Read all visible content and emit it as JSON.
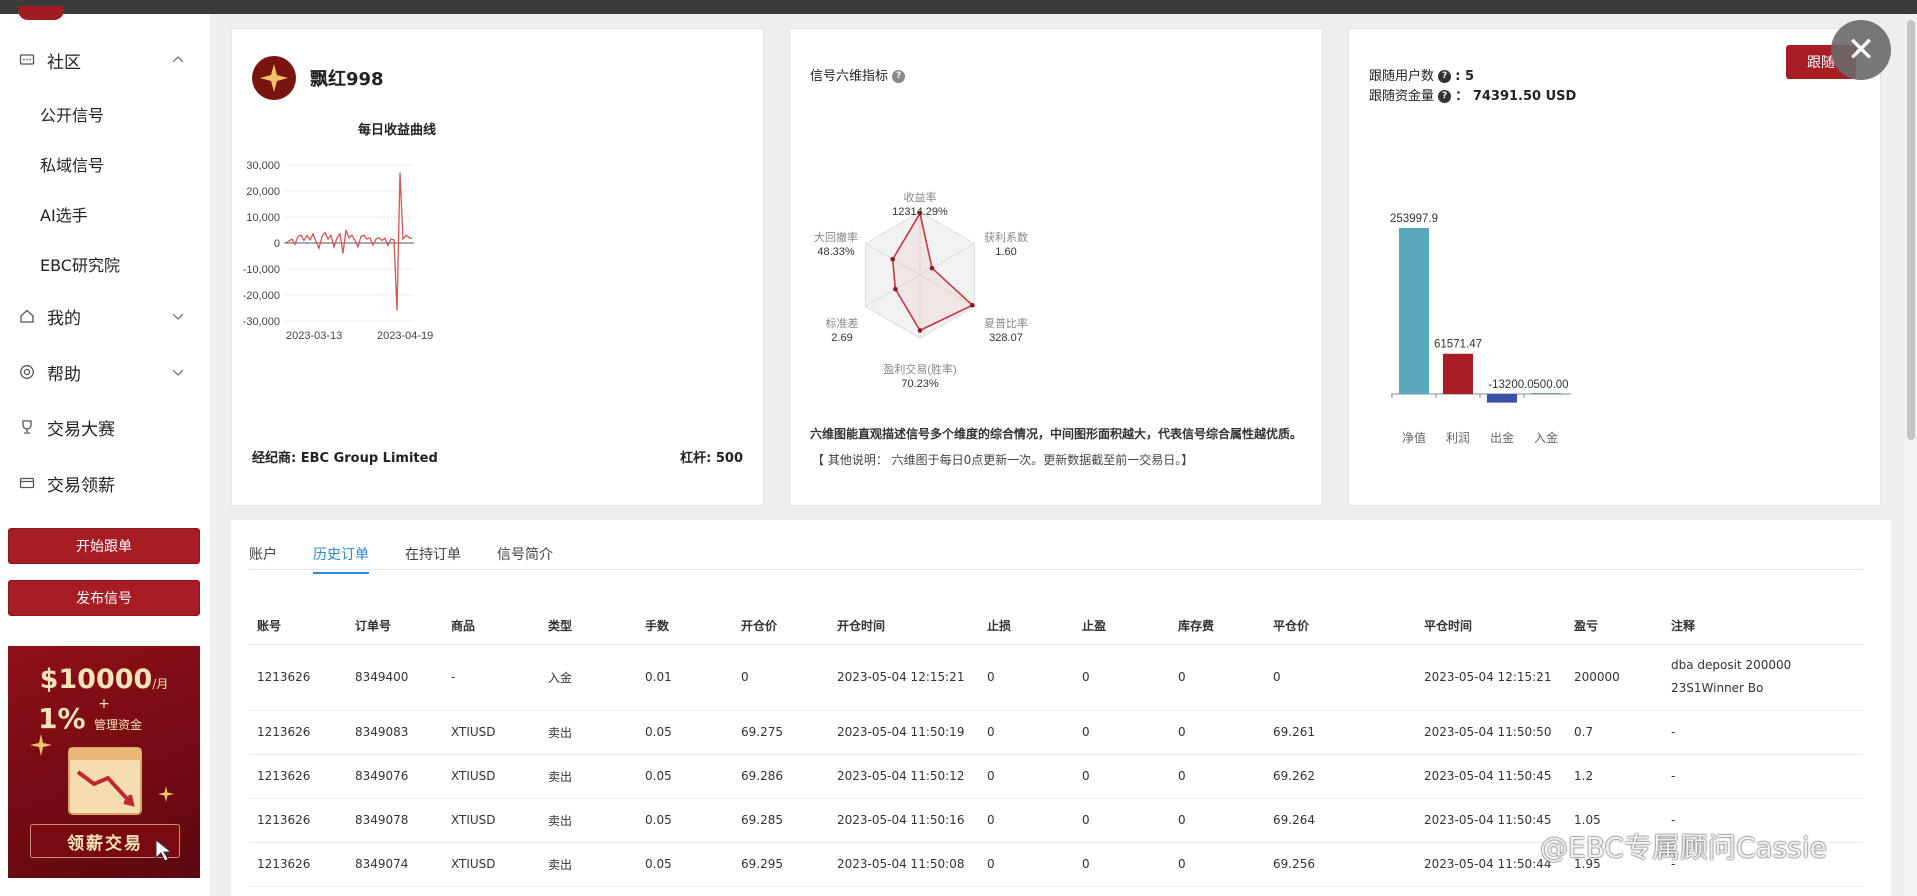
{
  "sidebar": {
    "community": "社区",
    "sub_items": [
      "公开信号",
      "私域信号",
      "AI选手",
      "EBC研究院"
    ],
    "mine": "我的",
    "help": "帮助",
    "contest": "交易大赛",
    "salary": "交易领薪",
    "start_copy": "开始跟单",
    "publish_signal": "发布信号",
    "promo": {
      "amount": "$10000",
      "per_month": "/月",
      "plus": "+",
      "percent": "1%",
      "mgmt": "管理资金",
      "cta": "领薪交易"
    }
  },
  "profile": {
    "name": "飘红998",
    "chart_title": "每日收益曲线",
    "broker_label": "经纪商: EBC Group Limited",
    "leverage_label": "杠杆: 500"
  },
  "radar": {
    "title": "信号六维指标",
    "description": "六维图能直观描述信号多个维度的综合情况，中间图形面积越大，代表信号综合属性越优质。",
    "note": "【 其他说明： 六维图于每日0点更新一次。更新数据截至前一交易日。】",
    "axes": [
      {
        "label": "收益率",
        "value": "12314.29%"
      },
      {
        "label": "获利系数",
        "value": "1.60"
      },
      {
        "label": "夏普比率",
        "value": "328.07"
      },
      {
        "label": "盈利交易(胜率)",
        "value": "70.23%"
      },
      {
        "label": "标准差",
        "value": "2.69"
      },
      {
        "label": "大回撤率",
        "value": "48.33%"
      }
    ]
  },
  "follow": {
    "users_label": "跟随用户数",
    "users_value": ": 5",
    "funds_label": "跟随资金量",
    "funds_value": "： 74391.50 USD",
    "button": "跟随",
    "close": "✕"
  },
  "tabs": [
    "账户",
    "历史订单",
    "在持订单",
    "信号简介"
  ],
  "table": {
    "headers": [
      "账号",
      "订单号",
      "商品",
      "类型",
      "手数",
      "开仓价",
      "开仓时间",
      "止损",
      "止盈",
      "库存费",
      "平仓价",
      "平仓时间",
      "盈亏",
      "注释"
    ],
    "rows": [
      [
        "1213626",
        "8349400",
        "-",
        "入金",
        "0.01",
        "0",
        "2023-05-04 12:15:21",
        "0",
        "0",
        "0",
        "0",
        "2023-05-04 12:15:21",
        "200000",
        "dba deposit 200000 23S1Winner Bo"
      ],
      [
        "1213626",
        "8349083",
        "XTIUSD",
        "卖出",
        "0.05",
        "69.275",
        "2023-05-04 11:50:19",
        "0",
        "0",
        "0",
        "69.261",
        "2023-05-04 11:50:50",
        "0.7",
        "-"
      ],
      [
        "1213626",
        "8349076",
        "XTIUSD",
        "卖出",
        "0.05",
        "69.286",
        "2023-05-04 11:50:12",
        "0",
        "0",
        "0",
        "69.262",
        "2023-05-04 11:50:45",
        "1.2",
        "-"
      ],
      [
        "1213626",
        "8349078",
        "XTIUSD",
        "卖出",
        "0.05",
        "69.285",
        "2023-05-04 11:50:16",
        "0",
        "0",
        "0",
        "69.264",
        "2023-05-04 11:50:45",
        "1.05",
        "-"
      ],
      [
        "1213626",
        "8349074",
        "XTIUSD",
        "卖出",
        "0.05",
        "69.295",
        "2023-05-04 11:50:08",
        "0",
        "0",
        "0",
        "69.256",
        "2023-05-04 11:50:44",
        "1.95",
        "-"
      ]
    ]
  },
  "watermark": "@EBC专属顾问Cassie",
  "colors": {
    "brand": "#a81c24",
    "accent": "#2b8ad8",
    "line": "#d9534f"
  },
  "chart_data": [
    {
      "type": "line",
      "title": "每日收益曲线",
      "x_ticks": [
        "2023-03-13",
        "2023-04-19"
      ],
      "y_ticks": [
        "30,000",
        "20,000",
        "10,000",
        "0",
        "-10,000",
        "-20,000",
        "-30,000"
      ],
      "ylim": [
        -30000,
        30000
      ],
      "values": [
        0,
        800,
        1500,
        -500,
        2500,
        3000,
        1000,
        2800,
        1200,
        3500,
        500,
        -2000,
        2500,
        4000,
        1500,
        3000,
        -1500,
        2000,
        3500,
        -4000,
        5000,
        2000,
        3000,
        1000,
        -1500,
        2500,
        3000,
        1500,
        2000,
        -800,
        1500,
        2000,
        1000,
        1800,
        -1000,
        1500,
        1200,
        -26000,
        27000,
        1500,
        3000,
        2000,
        1800
      ]
    },
    {
      "type": "bar",
      "categories": [
        "净值",
        "利润",
        "出金",
        "入金"
      ],
      "values": [
        253997.9,
        61571.47,
        -13200.0,
        500.0
      ],
      "labels": [
        "253997.9",
        "61571.47",
        "-13200.0",
        "500.00"
      ],
      "colors": [
        "#5aa8bd",
        "#a81c24",
        "#3a4fa8",
        "#5aa8bd"
      ]
    }
  ]
}
